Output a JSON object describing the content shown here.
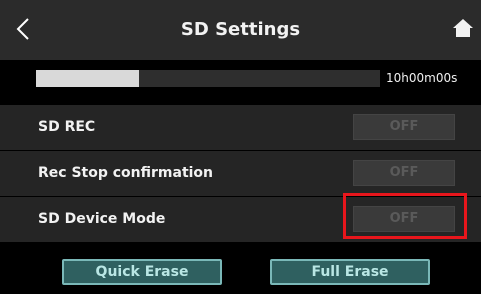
{
  "header": {
    "title": "SD Settings",
    "back_icon": "chevron-left-icon",
    "home_icon": "home-icon"
  },
  "storage": {
    "used_fraction": 0.3,
    "time_remaining": "10h00m00s"
  },
  "settings": [
    {
      "label": "SD REC",
      "value": "OFF"
    },
    {
      "label": "Rec Stop confirmation",
      "value": "OFF"
    },
    {
      "label": "SD Device Mode",
      "value": "OFF"
    }
  ],
  "footer": {
    "quick_erase": "Quick Erase",
    "full_erase": "Full Erase"
  },
  "colors": {
    "highlight": "#e8161c",
    "erase_button": "#2f6060",
    "erase_text": "#b9e6e4"
  }
}
